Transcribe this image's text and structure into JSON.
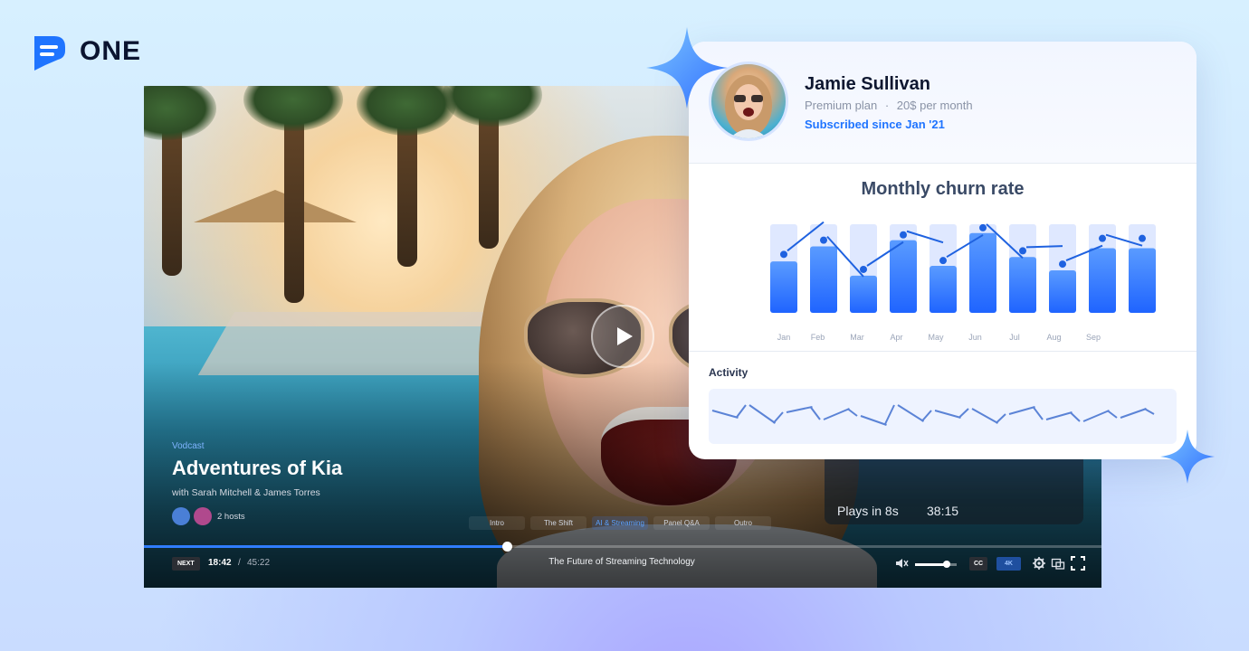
{
  "brand": {
    "name": "ONE",
    "color": "#1f74ff"
  },
  "player": {
    "category": "Vodcast",
    "title": "Adventures of Kia",
    "hosts_line": "with Sarah Mitchell & James Torres",
    "hosts_count": "2 hosts",
    "chapters": [
      {
        "label": "Intro",
        "active": false
      },
      {
        "label": "The Shift",
        "active": false
      },
      {
        "label": "AI & Streaming",
        "active": true
      },
      {
        "label": "Panel Q&A",
        "active": false
      },
      {
        "label": "Outro",
        "active": false
      }
    ],
    "progress": 0.379,
    "buffered": 0.55,
    "next_label": "NEXT",
    "current_time": "18:42",
    "time_separator": "/",
    "total_time": "45:22",
    "episode_title": "The Future of Streaming Technology",
    "volume": 0.75,
    "cc_label": "CC",
    "quality_label": "4K",
    "up_next": {
      "plays_in": "Plays in 8s",
      "duration": "38:15"
    },
    "icons": [
      "play-icon",
      "mute-icon",
      "settings-icon",
      "pip-icon",
      "fullscreen-icon"
    ]
  },
  "profile": {
    "name": "Jamie Sullivan",
    "plan": "Premium plan",
    "price": "20$ per month",
    "plan_separator": "·",
    "since": "Subscribed since Jan '21"
  },
  "chart_data": {
    "type": "bar",
    "title": "Monthly churn rate",
    "categories": [
      "Jan",
      "Feb",
      "Mar",
      "Apr",
      "May",
      "Jun",
      "Jul",
      "Aug",
      "Sep"
    ],
    "values": [
      58,
      75,
      42,
      82,
      53,
      90,
      63,
      48,
      73
    ],
    "markers": [
      66,
      82,
      49,
      88,
      59,
      96,
      70,
      55,
      84
    ],
    "ylim": [
      0,
      100
    ],
    "colors": {
      "bar": "#2f7dff",
      "track": "#dfe8ff",
      "line": "#1f62e0"
    }
  },
  "activity": {
    "label": "Activity",
    "values": [
      35,
      55,
      20,
      70,
      40,
      25,
      60,
      30,
      50,
      75,
      20,
      65,
      35,
      55,
      30,
      70,
      45,
      25,
      60,
      40,
      65,
      35,
      55,
      30,
      45
    ]
  }
}
